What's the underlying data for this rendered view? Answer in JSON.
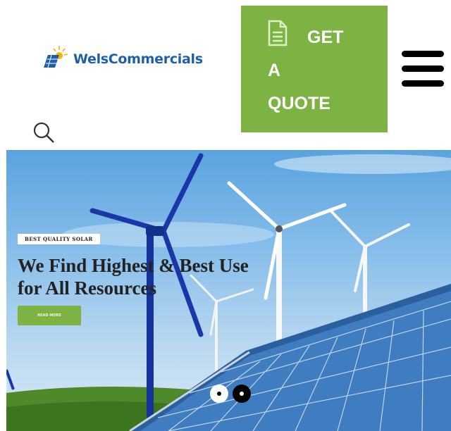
{
  "header": {
    "logo_text": "WelsCommercials",
    "quote_button": {
      "line1": "GET",
      "line2": "A",
      "line3": "QUOTE"
    },
    "icons": {
      "quote": "document-icon",
      "menu": "hamburger-menu-icon",
      "search": "search-icon"
    }
  },
  "hero": {
    "badge": "BEST QUALITY SOLAR",
    "headline": "We Find Highest & Best Use for All Resources",
    "read_more_label": "READ MORE",
    "slider": {
      "slides": 2,
      "active": 2
    }
  },
  "colors": {
    "accent": "#7cb342",
    "brand_blue": "#1f5fa8",
    "sky": "#86bdea"
  }
}
